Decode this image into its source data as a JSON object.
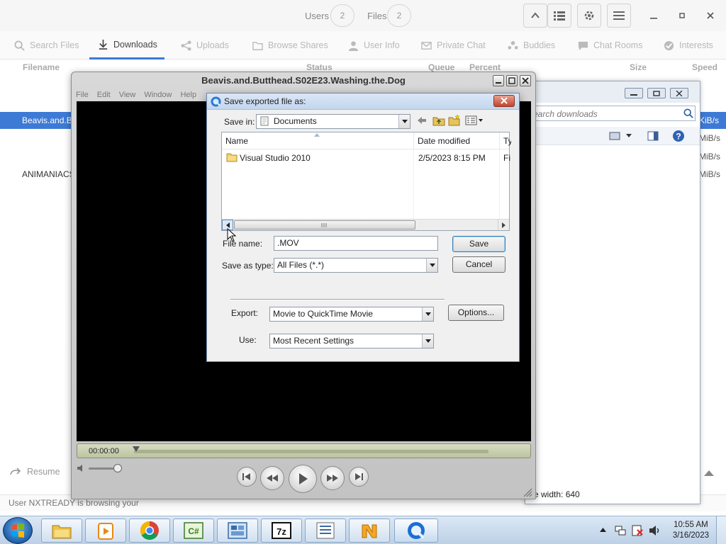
{
  "background_app": {
    "header": {
      "users_label": "Users",
      "users_count": "2",
      "files_label": "Files",
      "files_count": "2"
    },
    "tabs": [
      {
        "label": "Search Files",
        "icon": "search-icon"
      },
      {
        "label": "Downloads",
        "icon": "download-icon"
      },
      {
        "label": "Uploads",
        "icon": "upload-icon"
      },
      {
        "label": "Browse Shares",
        "icon": "folder-icon"
      },
      {
        "label": "User Info",
        "icon": "user-icon"
      },
      {
        "label": "Private Chat",
        "icon": "mail-icon"
      },
      {
        "label": "Buddies",
        "icon": "buddies-icon"
      },
      {
        "label": "Chat Rooms",
        "icon": "chat-icon"
      },
      {
        "label": "Interests",
        "icon": "check-circle-icon"
      }
    ],
    "columns": {
      "filename": "Filename",
      "status": "Status",
      "queue": "Queue",
      "percent": "Percent",
      "size": "Size",
      "speed": "Speed"
    },
    "rows": [
      {
        "filename": "Beavis.and.Bu",
        "speed": "KiB/s"
      },
      {
        "speed": "MiB/s"
      },
      {
        "speed": "MiB/s"
      },
      {
        "filename": "ANIMANIACS",
        "speed": "MiB/s"
      }
    ],
    "resume_label": "Resume",
    "status_bar": "User NXTREADY is browsing your"
  },
  "download_window": {
    "search_placeholder": "Search downloads",
    "search_visible": "earch downloads",
    "frame_width_label": "e width:",
    "frame_width_value": "640"
  },
  "quicktime": {
    "title": "Beavis.and.Butthead.S02E23.Washing.the.Dog",
    "menu": [
      "File",
      "Edit",
      "View",
      "Window",
      "Help"
    ],
    "time": "00:00:00"
  },
  "dialog": {
    "title": "Save exported file as:",
    "save_in_label": "Save in:",
    "save_in_value": "Documents",
    "columns": {
      "name": "Name",
      "date": "Date modified",
      "type": "Ty"
    },
    "files": [
      {
        "name": "Visual Studio 2010",
        "date": "2/5/2023 8:15 PM",
        "type": "Fi"
      }
    ],
    "file_name_label": "File name:",
    "file_name_value": ".MOV",
    "save_type_label": "Save as type:",
    "save_type_value": "All Files (*.*)",
    "save_button": "Save",
    "cancel_button": "Cancel",
    "export_label": "Export:",
    "export_value": "Movie to QuickTime Movie",
    "options_button": "Options...",
    "use_label": "Use:",
    "use_value": "Most Recent Settings"
  },
  "taskbar": {
    "apps": [
      "explorer-icon",
      "media-player-icon",
      "chrome-icon",
      "csharp-icon",
      "control-panel-icon",
      "7zip-icon",
      "list-app-icon",
      "nicotine-icon",
      "quicktime-icon"
    ],
    "clock_time": "10:55 AM",
    "clock_date": "3/16/2023"
  },
  "colors": {
    "accent": "#3d7ad6",
    "video": "#000000",
    "taskbar": "#c7d9ec"
  }
}
